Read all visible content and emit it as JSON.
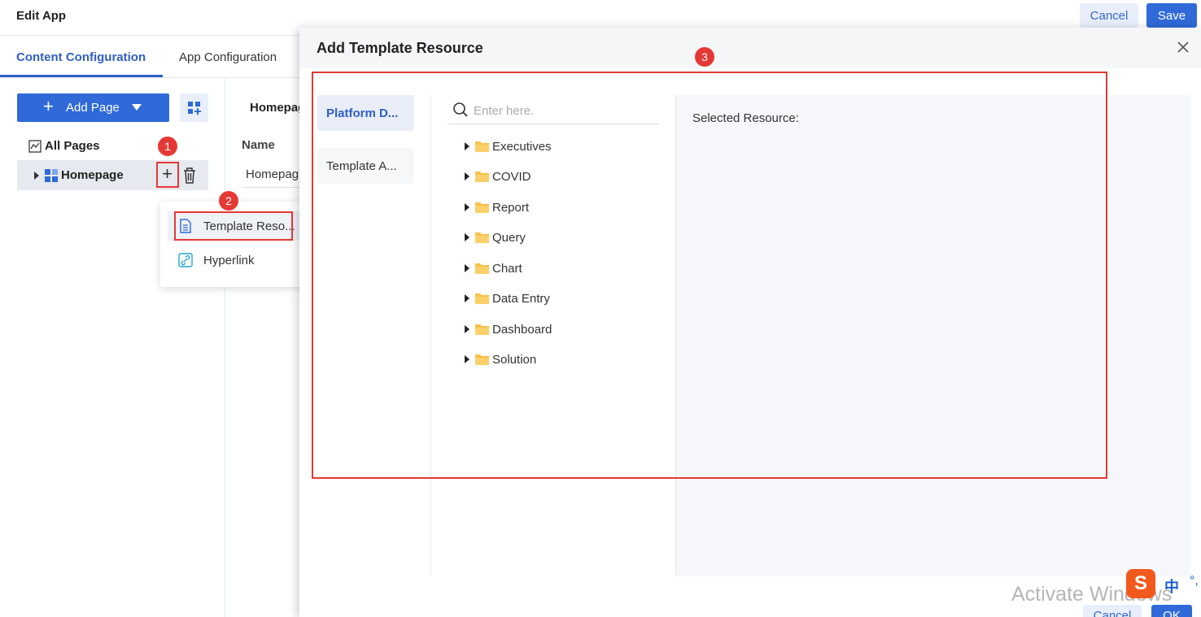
{
  "header": {
    "title": "Edit App",
    "cancel_label": "Cancel",
    "save_label": "Save"
  },
  "tabs": [
    {
      "label": "Content Configuration",
      "active": true
    },
    {
      "label": "App Configuration",
      "active": false
    }
  ],
  "sidebar": {
    "add_page_label": "Add Page",
    "all_pages_label": "All Pages",
    "homepage_label": "Homepage"
  },
  "context_menu": {
    "items": [
      {
        "label": "Template Reso...",
        "icon": "document-icon"
      },
      {
        "label": "Hyperlink",
        "icon": "link-icon"
      }
    ]
  },
  "main": {
    "title": "Homepag",
    "name_label": "Name",
    "name_value": "Homepag"
  },
  "annotations": {
    "badge1": "1",
    "badge2": "2",
    "badge3": "3"
  },
  "modal": {
    "title": "Add Template Resource",
    "side_tabs": [
      {
        "label": "Platform D...",
        "active": true
      },
      {
        "label": "Template A...",
        "active": false
      }
    ],
    "search_placeholder": "Enter here.",
    "tree": [
      "Executives",
      "COVID",
      "Report",
      "Query",
      "Chart",
      "Data Entry",
      "Dashboard",
      "Solution"
    ],
    "selected_label": "Selected Resource:",
    "footer_cancel": "Cancel",
    "footer_ok": "OK"
  },
  "system": {
    "watermark": "Activate Windows",
    "ime_logo": "S",
    "ime_lang": "中",
    "ime_dots": "°,"
  },
  "colors": {
    "primary": "#2f6ad8",
    "accent_text": "#2f5fc4",
    "annotation_red": "#e53935",
    "folder": "#f7c14a"
  }
}
